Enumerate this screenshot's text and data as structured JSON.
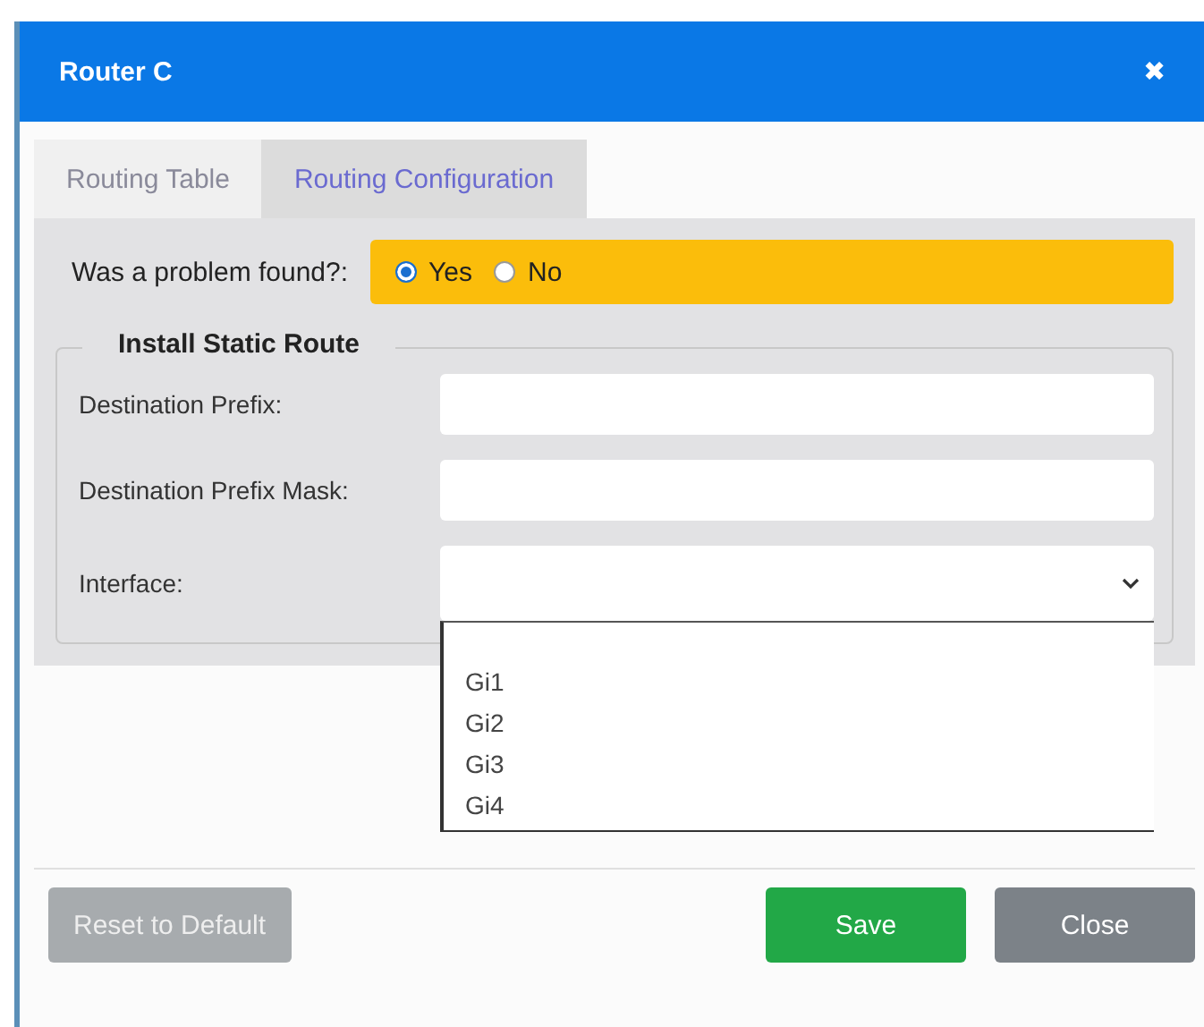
{
  "window": {
    "title": "Router C",
    "close": "✖"
  },
  "tabs": [
    {
      "label": "Routing Table",
      "selected": false
    },
    {
      "label": "Routing Configuration",
      "selected": true
    }
  ],
  "problem": {
    "label": "Was a problem found?:",
    "options": [
      {
        "label": "Yes",
        "selected": true
      },
      {
        "label": "No",
        "selected": false
      }
    ]
  },
  "static_route": {
    "title": "Install Static Route",
    "fields": [
      {
        "label": "Destination Prefix:",
        "kind": "text"
      },
      {
        "label": "Destination Prefix Mask:",
        "kind": "text"
      },
      {
        "label": "Interface:",
        "kind": "select",
        "expanded": true,
        "options": [
          "Gi1",
          "Gi2",
          "Gi3",
          "Gi4"
        ]
      }
    ]
  },
  "buttons": [
    {
      "label": "Reset to Default",
      "kind": "secondary",
      "disabled": true
    },
    {
      "label": "Save",
      "kind": "primary",
      "disabled": false
    },
    {
      "label": "Close",
      "kind": "neutral",
      "disabled": false
    }
  ]
}
